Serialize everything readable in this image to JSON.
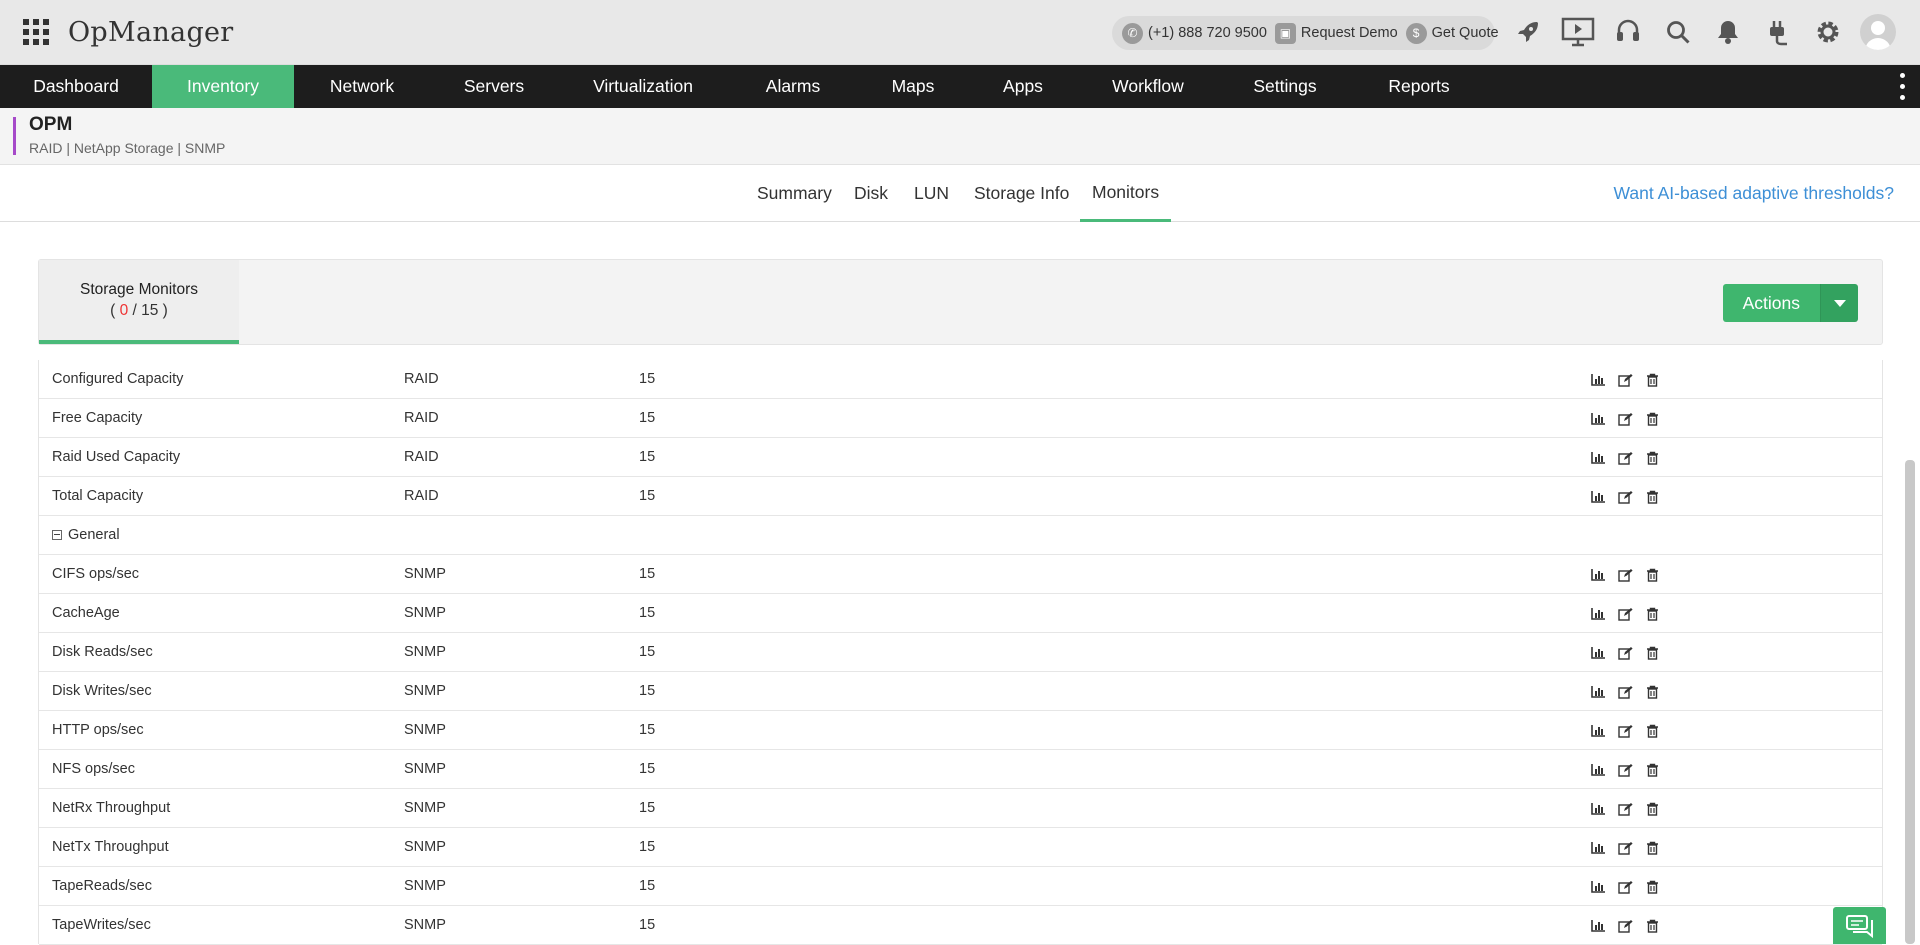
{
  "app": {
    "title": "OpManager"
  },
  "contact": {
    "phone": "(+1) 888 720 9500",
    "demo": "Request Demo",
    "quote": "Get Quote"
  },
  "nav": {
    "items": [
      {
        "label": "Dashboard"
      },
      {
        "label": "Inventory",
        "active": true
      },
      {
        "label": "Network"
      },
      {
        "label": "Servers"
      },
      {
        "label": "Virtualization"
      },
      {
        "label": "Alarms"
      },
      {
        "label": "Maps"
      },
      {
        "label": "Apps"
      },
      {
        "label": "Workflow"
      },
      {
        "label": "Settings"
      },
      {
        "label": "Reports"
      }
    ]
  },
  "device": {
    "name": "OPM",
    "sub": "RAID | NetApp Storage  | SNMP"
  },
  "tabs": [
    {
      "label": "Summary"
    },
    {
      "label": "Disk"
    },
    {
      "label": "LUN"
    },
    {
      "label": "Storage Info"
    },
    {
      "label": "Monitors",
      "active": true
    }
  ],
  "ai_link": "Want AI-based adaptive thresholds?",
  "monitors_panel": {
    "tab_label": "Storage Monitors",
    "count_open": "( ",
    "count_active": "0",
    "count_rest": " / 15 )",
    "actions_label": "Actions"
  },
  "group_label": "General",
  "rows_a": [
    {
      "name": "Configured Capacity",
      "protocol": "RAID",
      "interval": "15"
    },
    {
      "name": "Free Capacity",
      "protocol": "RAID",
      "interval": "15"
    },
    {
      "name": "Raid Used Capacity",
      "protocol": "RAID",
      "interval": "15"
    },
    {
      "name": "Total Capacity",
      "protocol": "RAID",
      "interval": "15"
    }
  ],
  "rows_b": [
    {
      "name": "CIFS ops/sec",
      "protocol": "SNMP",
      "interval": "15"
    },
    {
      "name": "CacheAge",
      "protocol": "SNMP",
      "interval": "15"
    },
    {
      "name": "Disk Reads/sec",
      "protocol": "SNMP",
      "interval": "15"
    },
    {
      "name": "Disk Writes/sec",
      "protocol": "SNMP",
      "interval": "15"
    },
    {
      "name": "HTTP ops/sec",
      "protocol": "SNMP",
      "interval": "15"
    },
    {
      "name": "NFS ops/sec",
      "protocol": "SNMP",
      "interval": "15"
    },
    {
      "name": "NetRx Throughput",
      "protocol": "SNMP",
      "interval": "15"
    },
    {
      "name": "NetTx Throughput",
      "protocol": "SNMP",
      "interval": "15"
    },
    {
      "name": "TapeReads/sec",
      "protocol": "SNMP",
      "interval": "15"
    },
    {
      "name": "TapeWrites/sec",
      "protocol": "SNMP",
      "interval": "15"
    }
  ],
  "colors": {
    "accent": "#4aba7a",
    "nav_bg": "#1d1d1d",
    "device_bar": "#a64ac9",
    "link": "#3d8fd6"
  },
  "icons": [
    "apps-grid-icon",
    "phone-icon",
    "demo-icon",
    "dollar-icon",
    "rocket-icon",
    "presentation-icon",
    "headset-icon",
    "search-icon",
    "bell-icon",
    "plug-icon",
    "gear-icon",
    "user-avatar-icon",
    "bar-chart-icon",
    "edit-icon",
    "trash-icon",
    "chat-icon"
  ]
}
